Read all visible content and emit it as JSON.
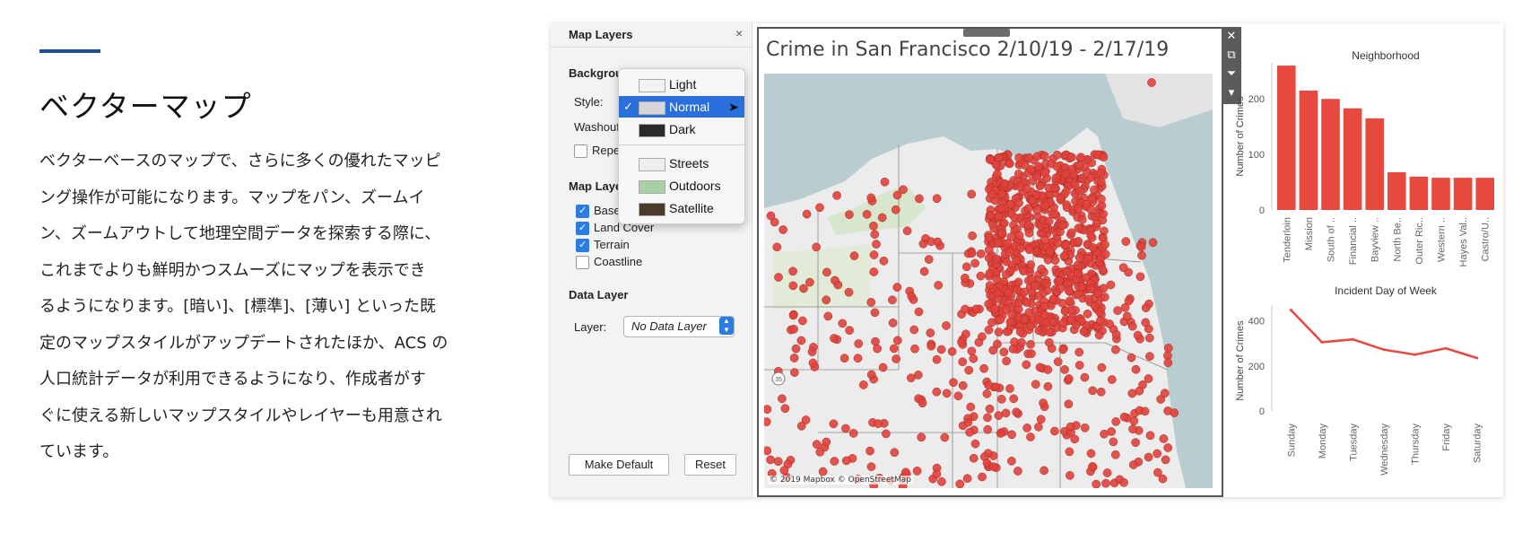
{
  "article": {
    "title": "ベクターマップ",
    "lines": [
      "ベクターベースのマップで、さらに多くの優れたマッピ",
      "ング操作が可能になります。マップをパン、ズームイ",
      "ン、ズームアウトして地理空間データを探索する際に、",
      "これまでよりも鮮明かつスムーズにマップを表示でき",
      "るようになります。[暗い]、[標準]、[薄い] といった既",
      "定のマップスタイルがアップデートされたほか、ACS の",
      "人口統計データが利用できるようになり、作成者がす",
      "ぐに使える新しいマップスタイルやレイヤーも用意され",
      "ています。"
    ],
    "accent_color": "#1f4e9a"
  },
  "panel": {
    "title": "Map Layers",
    "close_icon": "×",
    "background_heading": "Backgrou",
    "style_label": "Style:",
    "washout_label": "Washout",
    "repeat_label": "Repe",
    "map_layers_heading": "Map Laye",
    "layers": [
      {
        "label": "Base",
        "checked": true
      },
      {
        "label": "Land Cover",
        "checked": true
      },
      {
        "label": "Terrain",
        "checked": true
      },
      {
        "label": "Coastline",
        "checked": false
      }
    ],
    "data_layer_heading": "Data Layer",
    "layer_label": "Layer:",
    "layer_value": "No Data Layer",
    "make_default_label": "Make Default",
    "reset_label": "Reset"
  },
  "style_dropdown": {
    "items": [
      {
        "label": "Light",
        "swatch": "#f2f2f2",
        "selected": false
      },
      {
        "label": "Normal",
        "swatch": "#d4d6d8",
        "selected": true
      },
      {
        "label": "Dark",
        "swatch": "#2a2a2a",
        "selected": false
      },
      {
        "label": "Streets",
        "swatch": "#eeeeee",
        "selected": false
      },
      {
        "label": "Outdoors",
        "swatch": "#a9cfa4",
        "selected": false
      },
      {
        "label": "Satellite",
        "swatch": "#4a3a2a",
        "selected": false
      }
    ],
    "selected_color": "#2a6fdb"
  },
  "map": {
    "title": "Crime in San Francisco 2/10/19 - 2/17/19",
    "attribution": "© 2019 Mapbox © OpenStreetMap",
    "route_shield": "35",
    "point_color": "#e0423b",
    "water_color": "#b9ccd0",
    "land_color": "#ececec",
    "toolbar_icons": [
      "close-icon",
      "popout-icon",
      "filter-icon",
      "more-icon"
    ]
  },
  "chart_data": [
    {
      "type": "bar",
      "title": "Neighborhood",
      "ylabel": "Number of Crimes",
      "categories": [
        "Tenderloin",
        "Mission",
        "South of ..",
        "Financial ..",
        "Bayview ..",
        "North Be..",
        "Outer Ric..",
        "Western ..",
        "Hayes Val..",
        "Castro/U.."
      ],
      "values": [
        260,
        215,
        200,
        183,
        165,
        68,
        60,
        58,
        58,
        58
      ],
      "ylim": [
        0,
        265
      ],
      "yticks": [
        0,
        100,
        200
      ],
      "color": "#e8493f",
      "grid": false
    },
    {
      "type": "line",
      "title": "Incident Day of Week",
      "ylabel": "Number of Crimes",
      "categories": [
        "Sunday",
        "Monday",
        "Tuesday",
        "Wednesday",
        "Thursday",
        "Friday",
        "Saturday"
      ],
      "values": [
        448,
        305,
        318,
        272,
        250,
        278,
        235
      ],
      "ylim": [
        0,
        470
      ],
      "yticks": [
        0,
        200,
        400
      ],
      "color": "#e8493f",
      "grid": false
    }
  ]
}
